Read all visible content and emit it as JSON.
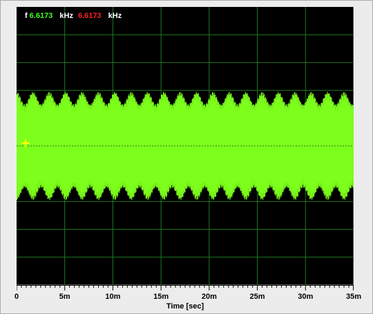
{
  "readout": {
    "label": "f",
    "value_1": "6.6173",
    "unit_1": "kHz",
    "value_2": "6.6173",
    "unit_2": "kHz"
  },
  "chart_data": {
    "type": "line",
    "xlabel": "Time [sec]",
    "ylabel": "",
    "x_ticks": [
      "0",
      "5m",
      "10m",
      "15m",
      "20m",
      "25m",
      "30m",
      "35m"
    ],
    "xlim": [
      0,
      0.035
    ],
    "ylim": [
      -1,
      1
    ],
    "grid": true,
    "series": [
      {
        "color": "#7dff1c",
        "frequency_hz": 6617.3,
        "amplitude_peak": 0.39,
        "amplitude_min": 0.3,
        "beat_period_s": 0.0017,
        "offset": 0.0
      }
    ],
    "cursor": {
      "x": 0.0005,
      "y": 0.02,
      "color": "#ffff00"
    },
    "background": "#000000",
    "grid_color": "#1f7a1f"
  }
}
